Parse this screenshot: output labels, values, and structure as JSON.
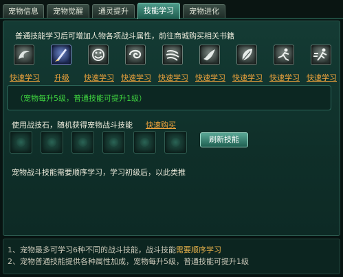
{
  "tabs": [
    {
      "label": "宠物信息",
      "active": false
    },
    {
      "label": "宠物觉醒",
      "active": false
    },
    {
      "label": "通灵提升",
      "active": false
    },
    {
      "label": "技能学习",
      "active": true
    },
    {
      "label": "宠物进化",
      "active": false
    }
  ],
  "description": "普通技能学习后可增加人物各项战斗属性，前往商城购买相关书籍",
  "skills": [
    {
      "icon": "swirl-claw-icon",
      "action": "快速学习"
    },
    {
      "icon": "blue-blade-icon",
      "action": "升级"
    },
    {
      "icon": "grin-face-icon",
      "action": "快速学习"
    },
    {
      "icon": "spiral-wind-icon",
      "action": "快速学习"
    },
    {
      "icon": "claw-swipe-icon",
      "action": "快速学习"
    },
    {
      "icon": "wing-strike-icon",
      "action": "快速学习"
    },
    {
      "icon": "leaf-feather-icon",
      "action": "快速学习"
    },
    {
      "icon": "lunge-figure-icon",
      "action": "快速学习"
    },
    {
      "icon": "dash-figure-icon",
      "action": "快速学习"
    }
  ],
  "info_text": "（宠物每升5级，普通技能可提升1级）",
  "battle_stone_text": "使用战技石，随机获得宠物战斗技能",
  "buy_link": "快速购买",
  "battle_slots_count": 6,
  "refresh_button": "刷新技能",
  "order_note": "宠物战斗技能需要顺序学习，学习初级后，以此类推",
  "tips": [
    {
      "prefix": "1、宠物最多可学习6种不同的战斗技能，战斗技能",
      "highlight": "需要顺序学习"
    },
    {
      "prefix": "2、宠物普通技能提供各种属性加成，宠物每升5级，普通技能可提升1级",
      "highlight": ""
    }
  ]
}
